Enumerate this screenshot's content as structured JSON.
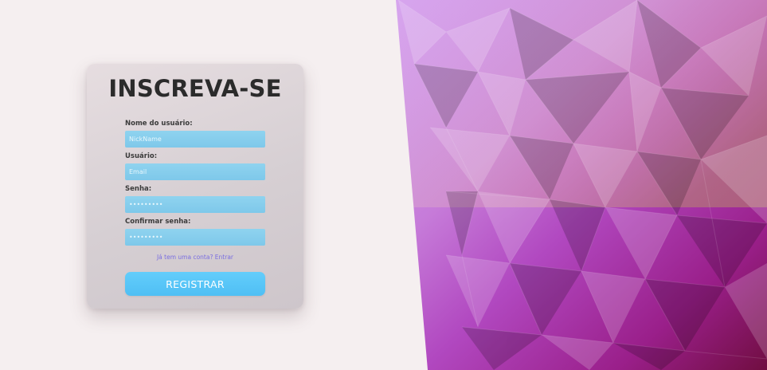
{
  "colors": {
    "page_background": "#f5eff0",
    "card_background": "#ddd5d9",
    "input_background": "#86cdec",
    "button_background": "#59c6f8",
    "link_color": "#7a6ee0",
    "art_top_left": "#d39ff0",
    "art_bottom_right": "#7a0f48"
  },
  "signup": {
    "title": "INSCREVA-SE",
    "fields": [
      {
        "label": "Nome do usuário:",
        "placeholder": "NickName",
        "type": "text"
      },
      {
        "label": "Usuário:",
        "placeholder": "Email",
        "type": "email"
      },
      {
        "label": "Senha:",
        "placeholder": "•••••••••",
        "type": "password"
      },
      {
        "label": "Confirmar senha:",
        "placeholder": "•••••••••",
        "type": "password"
      }
    ],
    "login_link": "Já tem uma conta? Entrar",
    "submit_label": "REGISTRAR"
  },
  "background_art": {
    "icon": "low-poly-gradient-art"
  }
}
